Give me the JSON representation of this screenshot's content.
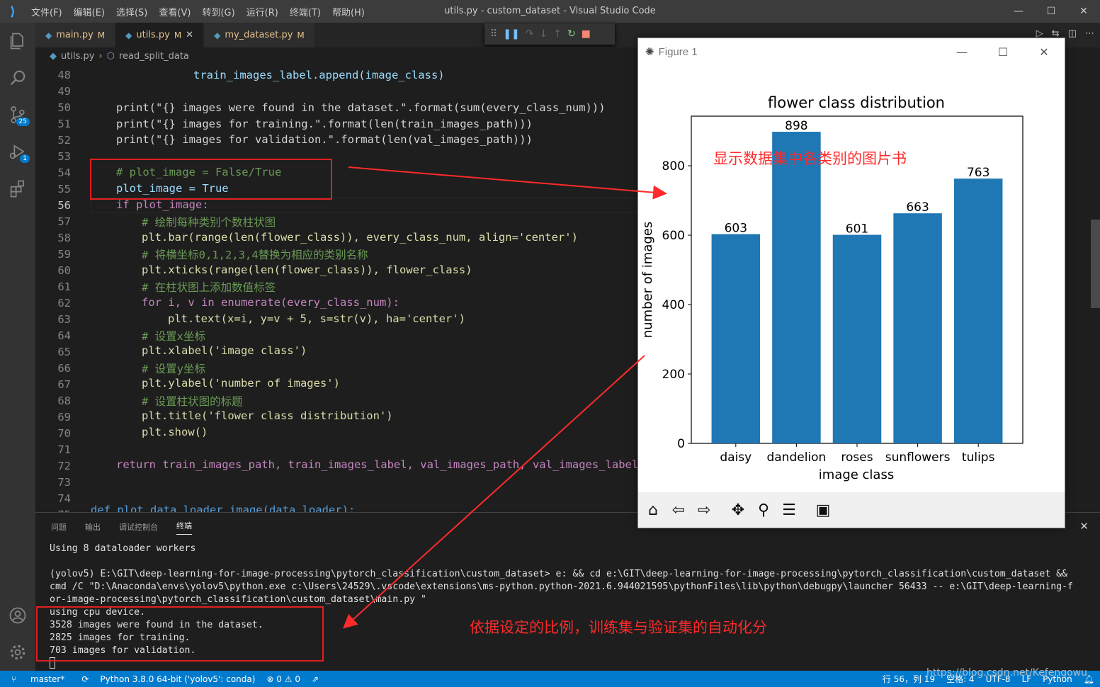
{
  "titlebar": {
    "menus": [
      "文件(F)",
      "编辑(E)",
      "选择(S)",
      "查看(V)",
      "转到(G)",
      "运行(R)",
      "终端(T)",
      "帮助(H)"
    ],
    "window_title": "utils.py - custom_dataset - Visual Studio Code"
  },
  "tabs": [
    {
      "name": "main.py",
      "mod": "M"
    },
    {
      "name": "utils.py",
      "mod": "M"
    },
    {
      "name": "my_dataset.py",
      "mod": "M"
    }
  ],
  "activity": {
    "scm_badge": "25",
    "debug_badge": "1"
  },
  "breadcrumb": {
    "file": "utils.py",
    "symbol": "read_split_data"
  },
  "code_lines": {
    "l48": "train_images_label.append(image_class)",
    "l50": "print(\"{} images were found in the dataset.\".format(sum(every_class_num)))",
    "l51": "print(\"{} images for training.\".format(len(train_images_path)))",
    "l52": "print(\"{} images for validation.\".format(len(val_images_path)))",
    "l54": "# plot_image = False/True",
    "l55": "plot_image = True",
    "l56": "if plot_image:",
    "l57": "# 绘制每种类别个数柱状图",
    "l58": "plt.bar(range(len(flower_class)), every_class_num, align='center')",
    "l59": "# 将横坐标0,1,2,3,4替换为相应的类别名称",
    "l60": "plt.xticks(range(len(flower_class)), flower_class)",
    "l61": "# 在柱状图上添加数值标签",
    "l62": "for i, v in enumerate(every_class_num):",
    "l63": "plt.text(x=i, y=v + 5, s=str(v), ha='center')",
    "l64": "# 设置x坐标",
    "l65": "plt.xlabel('image class')",
    "l66": "# 设置y坐标",
    "l67": "plt.ylabel('number of images')",
    "l68": "# 设置柱状图的标题",
    "l69": "plt.title('flower class distribution')",
    "l70": "plt.show()",
    "l72": "return train_images_path, train_images_label, val_images_path, val_images_label",
    "l75": "def plot_data_loader_image(data_loader):"
  },
  "line_numbers": [
    "48",
    "49",
    "50",
    "51",
    "52",
    "53",
    "54",
    "55",
    "56",
    "57",
    "58",
    "59",
    "60",
    "61",
    "62",
    "63",
    "64",
    "65",
    "66",
    "67",
    "68",
    "69",
    "70",
    "71",
    "72",
    "73",
    "74",
    "75"
  ],
  "panel": {
    "tabs": [
      "问题",
      "输出",
      "调试控制台",
      "终端"
    ],
    "terminal_lines": [
      "Using 8 dataloader workers",
      "",
      "(yolov5) E:\\GIT\\deep-learning-for-image-processing\\pytorch_classification\\custom_dataset> e: && cd e:\\GIT\\deep-learning-for-image-processing\\pytorch_classification\\custom_dataset &&",
      "cmd /C \"D:\\Anaconda\\envs\\yolov5\\python.exe c:\\Users\\24529\\.vscode\\extensions\\ms-python.python-2021.6.944021595\\pythonFiles\\lib\\python\\debugpy\\launcher 56433 -- e:\\GIT\\deep-learning-f",
      "or-image-processing\\pytorch_classification\\custom_dataset\\main.py \"",
      "using cpu device.",
      "3528 images were found in the dataset.",
      "2825 images for training.",
      "703 images for validation."
    ]
  },
  "statusbar": {
    "branch": "master*",
    "interpreter": "Python 3.8.0 64-bit ('yolov5': conda)",
    "problems": "⊗ 0 ⚠ 0",
    "position": "行 56，列 19",
    "spaces": "空格: 4",
    "encoding": "UTF-8",
    "eol": "LF",
    "language": "Python"
  },
  "watermark": "https://blog.csdn.net/Kefengowu",
  "figure": {
    "window_title": "Figure 1"
  },
  "chart_data": {
    "type": "bar",
    "title": "flower class distribution",
    "xlabel": "image class",
    "ylabel": "number of images",
    "categories": [
      "daisy",
      "dandelion",
      "roses",
      "sunflowers",
      "tulips"
    ],
    "values": [
      603,
      898,
      601,
      663,
      763
    ],
    "value_labels": [
      "603",
      "898",
      "601",
      "663",
      "763"
    ],
    "yticks": [
      0,
      200,
      400,
      600,
      800
    ],
    "ytick_labels": [
      "0",
      "200",
      "400",
      "600",
      "800"
    ],
    "ylim": [
      0,
      943
    ],
    "bar_color": "#1f77b4",
    "grid": false
  },
  "annotations": {
    "chart_note": "显示数据集中各类别的图片书",
    "terminal_note": "依据设定的比例，训练集与验证集的自动化分",
    "color": "#ff2a2a"
  }
}
